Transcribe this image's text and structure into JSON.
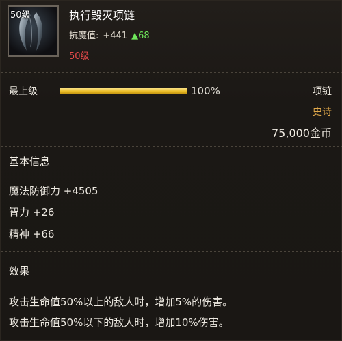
{
  "item": {
    "icon_level": "50级",
    "name": "执行毁灭项链",
    "stat_label": "抗魔值:",
    "stat_value": "+441",
    "stat_up_arrow": "▲",
    "stat_up": "68",
    "required_level": "50级",
    "icon_name": "necklace-claw-icon"
  },
  "rank": {
    "label": "最上级",
    "progress_percent": 100,
    "percent_text": "100%"
  },
  "meta": {
    "type": "项链",
    "quality": "史诗",
    "price": "75,000金币"
  },
  "basic_info": {
    "title": "基本信息",
    "attributes": [
      "魔法防御力 +4505",
      "智力 +26",
      "精神 +66"
    ]
  },
  "effects": {
    "title": "效果",
    "lines": [
      "攻击生命值50%以上的敌人时，增加5%的伤害。",
      "攻击生命值50%以下的敌人时，增加10%伤害。"
    ]
  },
  "colors": {
    "stat_up": "#6ee65a",
    "required_level": "#e84a4a",
    "quality": "#e0a84a",
    "bar": "#e8b820"
  }
}
